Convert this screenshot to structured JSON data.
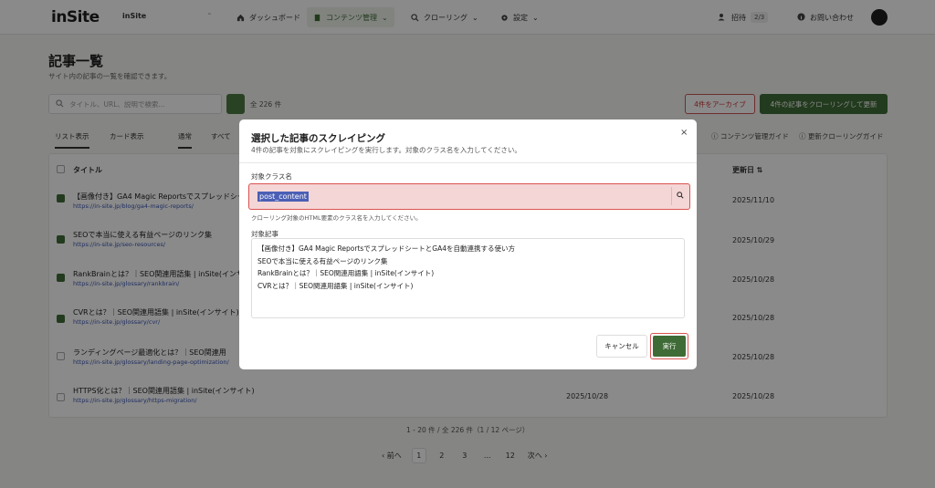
{
  "nav": {
    "logo": "inSite",
    "site_name": "inSite",
    "switcher": "⌃",
    "items": [
      {
        "label": "ダッシュボード"
      },
      {
        "label": "コンテンツ管理"
      },
      {
        "label": "クローリング"
      },
      {
        "label": "設定"
      }
    ],
    "invite_label": "招待",
    "invite_count": "2/3",
    "contact_label": "お問い合わせ"
  },
  "page": {
    "title": "記事一覧",
    "description": "サイト内の記事の一覧を確認できます。",
    "search_placeholder": "タイトル、URL、説明で検索...",
    "count_label": "全 226 件",
    "archive_button": "4件をアーカイブ",
    "crawl_button": "4件の記事をクローリングして更新",
    "view_tabs": [
      "リスト表示",
      "カード表示"
    ],
    "filter_tabs": [
      "通常",
      "すべて"
    ],
    "guide_links": [
      "コンテンツ管理ガイド",
      "更新クローリングガイド"
    ],
    "columns": {
      "title": "タイトル",
      "updated": "更新日 ⇅"
    }
  },
  "table": {
    "rows": [
      {
        "title": "【画像付き】GA4 Magic Reportsでスプレッドシー",
        "url": "https://in-site.jp/blog/ga4-magic-reports/",
        "date": "2025/11/10",
        "checked": true
      },
      {
        "title": "SEOで本当に使える有益ページのリンク集",
        "url": "https://in-site.jp/seo-resources/",
        "date": "2025/10/29",
        "checked": true
      },
      {
        "title": "RankBrainとは？｜SEO関連用語集 | inSite(インサイ",
        "url": "https://in-site.jp/glossary/rankbrain/",
        "date": "2025/10/28",
        "checked": true
      },
      {
        "title": "CVRとは？｜SEO関連用語集 | inSite(インサイト)",
        "url": "https://in-site.jp/glossary/cvr/",
        "date": "2025/10/28",
        "checked": true
      },
      {
        "title": "ランディングページ最適化とは？｜SEO関連用",
        "url": "https://in-site.jp/glossary/landing-page-optimization/",
        "date": "2025/10/28",
        "checked": false
      },
      {
        "title": "HTTPS化とは？｜SEO関連用語集 | inSite(インサイト)",
        "url": "https://in-site.jp/glossary/https-migration/",
        "date": "2025/10/28",
        "date_mid": "2025/10/28",
        "checked": false
      }
    ]
  },
  "pager": {
    "info": "1 - 20 件 / 全 226 件（1 / 12 ページ）",
    "prev": "‹ 前へ",
    "pages": [
      "1",
      "2",
      "3",
      "...",
      "12"
    ],
    "next": "次へ ›"
  },
  "modal": {
    "title": "選択した記事のスクレイピング",
    "description": "4件の記事を対象にスクレイピングを実行します。対象のクラス名を入力してください。",
    "close": "×",
    "class_label": "対象クラス名",
    "class_value": "post_content",
    "class_hint": "クローリング対象のHTML要素のクラス名を入力してください。",
    "articles_label": "対象記事",
    "articles": [
      "【画像付き】GA4 Magic ReportsでスプレッドシートとGA4を自動連携する使い方",
      "SEOで本当に使える有益ページのリンク集",
      "RankBrainとは？｜SEO関連用語集 | inSite(インサイト)",
      "CVRとは？｜SEO関連用語集 | inSite(インサイト)"
    ],
    "cancel": "キャンセル",
    "run": "実行"
  }
}
